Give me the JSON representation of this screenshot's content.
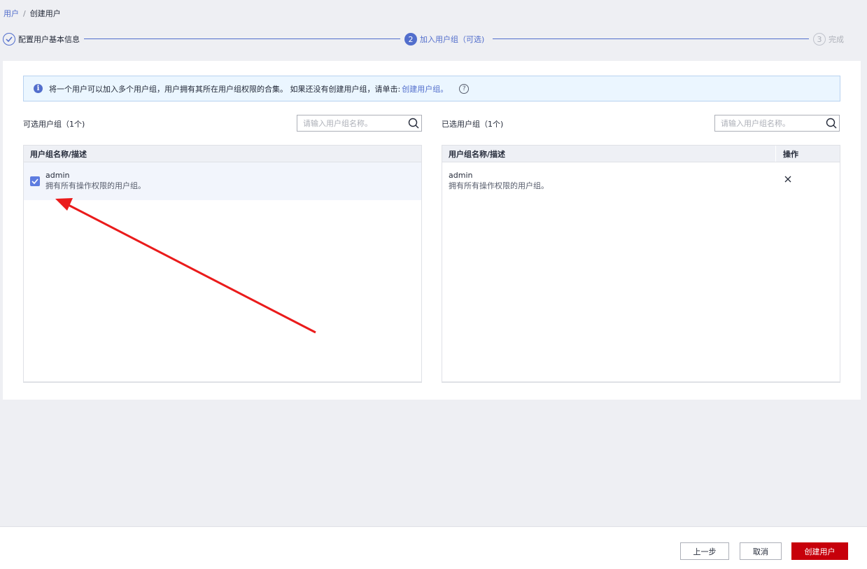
{
  "breadcrumb": {
    "parent": "用户",
    "separator": "/",
    "current": "创建用户"
  },
  "steps": [
    {
      "number": "✓",
      "label": "配置用户基本信息",
      "state": "done"
    },
    {
      "number": "2",
      "label": "加入用户组（可选)",
      "state": "active"
    },
    {
      "number": "3",
      "label": "完成",
      "state": "pending"
    }
  ],
  "info": {
    "icon": "info-icon",
    "text": "将一个用户可以加入多个用户组，用户拥有其所在用户组权限的合集。 如果还没有创建用户组，请单击:",
    "link": "创建用户组。",
    "help": "?"
  },
  "available": {
    "title": "可选用户组（1个)",
    "search_placeholder": "请输入用户组名称。",
    "column_header": "用户组名称/描述",
    "rows": [
      {
        "name": "admin",
        "desc": "拥有所有操作权限的用户组。",
        "checked": true
      }
    ]
  },
  "selected": {
    "title": "已选用户组（1个)",
    "search_placeholder": "请输入用户组名称。",
    "column_header": "用户组名称/描述",
    "op_header": "操作",
    "rows": [
      {
        "name": "admin",
        "desc": "拥有所有操作权限的用户组。",
        "remove_icon": "close-icon"
      }
    ]
  },
  "footer": {
    "prev": "上一步",
    "cancel": "取消",
    "create": "创建用户"
  },
  "colors": {
    "accent": "#526ecc",
    "primary_button": "#c7000b",
    "annotation_arrow": "#ea1b1b"
  }
}
